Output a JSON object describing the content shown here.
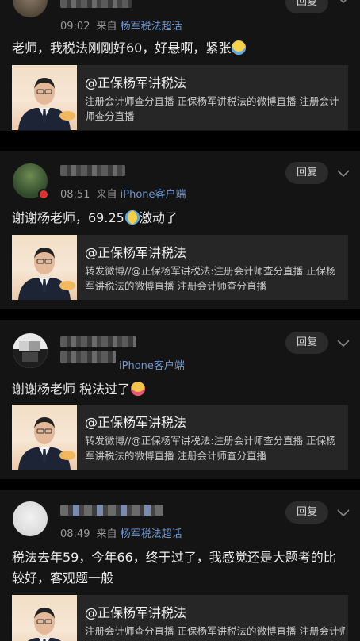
{
  "colors": {
    "background": "#000000",
    "card": "#141414",
    "link": "#6d97d6",
    "reply_bg": "#2b2b2b"
  },
  "posts": [
    {
      "time": "09:02",
      "source_prefix": "来自",
      "source": "杨军税法超话",
      "reply_label": "回复",
      "text": "老师，我税法刚刚好60，好悬啊，紧张",
      "emoji": "anxious-sweat-emoji",
      "card_title": "@正保杨军讲税法",
      "card_desc": "注册会计师查分直播 正保杨军讲税法的微博直播 注册会计师查分直播"
    },
    {
      "time": "08:51",
      "source_prefix": "来自",
      "source": "iPhone客户端",
      "reply_label": "回复",
      "text": "谢谢杨老师，69.25",
      "text_after": "激动了",
      "emoji": "tears-of-joy-emoji",
      "card_title": "@正保杨军讲税法",
      "card_desc": "转发微博//@正保杨军讲税法:注册会计师查分直播 正保杨军讲税法的微博直播 注册会计师查分直播"
    },
    {
      "time": "",
      "source_prefix": "",
      "source": "iPhone客户端",
      "reply_label": "回复",
      "text": "谢谢杨老师 税法过了",
      "emoji": "crying-emoji",
      "card_title": "@正保杨军讲税法",
      "card_desc": "转发微博//@正保杨军讲税法:注册会计师查分直播 正保杨军讲税法的微博直播 注册会计师查分直播"
    },
    {
      "time": "08:49",
      "source_prefix": "来自",
      "source": "杨军税法超话",
      "reply_label": "回复",
      "text": "税法去年59，今年66，终于过了，我感觉还是大题考的比较好，客观题一般",
      "card_title": "@正保杨军讲税法",
      "card_desc": "注册会计师查分直播 正保杨军讲税法的微博直播 注册会计师查分直播"
    }
  ]
}
